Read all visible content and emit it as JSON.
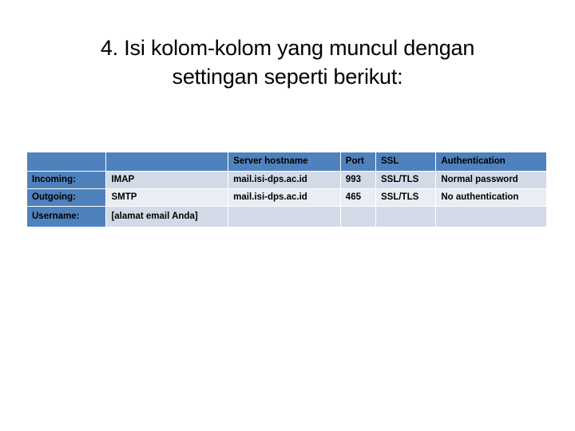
{
  "slide": {
    "title_line_1": "4. Isi kolom-kolom yang muncul dengan",
    "title_line_2": "settingan seperti berikut:",
    "background_color": "#FFFFFF"
  },
  "colors": {
    "header_blue": "#4F81BD",
    "band_dark": "#D3DAE7",
    "band_light": "#E9EDF4",
    "header_text": "#FFFFFF",
    "body_text": "#000000"
  },
  "table": {
    "headers": [
      "",
      "",
      "Server hostname",
      "Port",
      "SSL",
      "Authentication"
    ],
    "rows": [
      {
        "label": "Incoming:",
        "protocol": "IMAP",
        "hostname": "mail.isi-dps.ac.id",
        "port": "993",
        "ssl": "SSL/TLS",
        "authentication": "Normal password"
      },
      {
        "label": "Outgoing:",
        "protocol": "SMTP",
        "hostname": "mail.isi-dps.ac.id",
        "port": "465",
        "ssl": "SSL/TLS",
        "authentication": "No authentication"
      },
      {
        "label": "Username:",
        "protocol": "[alamat email Anda]",
        "hostname": "",
        "port": "",
        "ssl": "",
        "authentication": ""
      }
    ]
  }
}
